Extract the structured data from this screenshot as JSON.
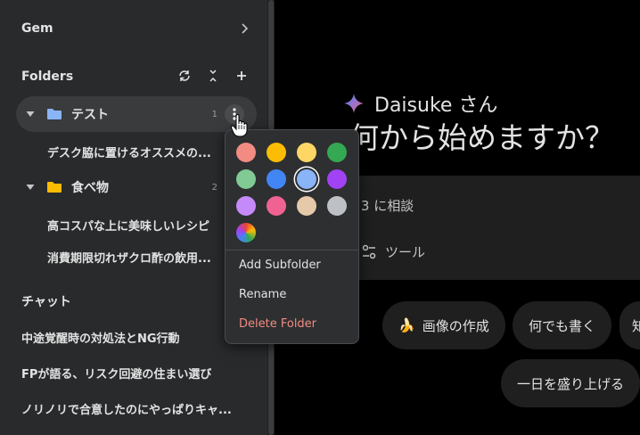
{
  "sidebar": {
    "gem_label": "Gem",
    "folders_label": "Folders",
    "folders": [
      {
        "name": "テスト",
        "count": "1",
        "color": "#8ab4f8",
        "chats": [
          "デスク脇に置けるオススメの..."
        ]
      },
      {
        "name": "食べ物",
        "count": "2",
        "color": "#fbbc04",
        "chats": [
          "高コスパな上に美味しいレシピ",
          "消費期限切れザクロ酢の飲用..."
        ]
      }
    ],
    "chats_label": "チャット",
    "chats": [
      "中途覚醒時の対処法とNG行動",
      "FPが語る、リスク回避の住まい選び",
      "ノリノリで合意したのにやっぱりキャ..."
    ]
  },
  "main": {
    "greeting_name": "Daisuke さん",
    "headline": "何から始めますか？",
    "prompt_placeholder": "i 3 に相談",
    "tools_label": "ツール",
    "chips": [
      {
        "icon": "🍌",
        "label": "画像の作成"
      },
      {
        "icon": "",
        "label": "何でも書く"
      },
      {
        "icon": "",
        "label": "知"
      },
      {
        "icon": "",
        "label": "一日を盛り上げる"
      }
    ]
  },
  "context_menu": {
    "colors": [
      "#f28b82",
      "#fbbc04",
      "#fdd663",
      "#34a853",
      "#81c995",
      "#4285f4",
      "#8ab4f8",
      "#a142f4",
      "#c58af9",
      "#f06292",
      "#e6c9a8",
      "#bdc1c6"
    ],
    "selected_color": "#8ab4f8",
    "items": {
      "add_subfolder": "Add Subfolder",
      "rename": "Rename",
      "delete_folder": "Delete Folder"
    }
  }
}
